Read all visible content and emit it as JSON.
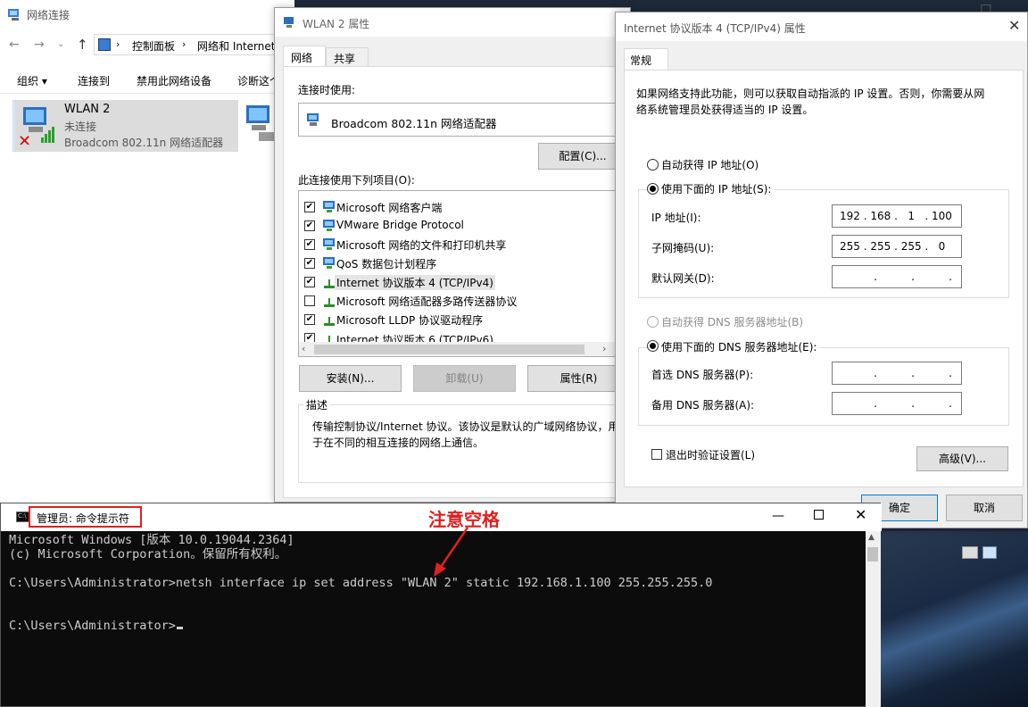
{
  "network_window": {
    "title": "网络连接",
    "breadcrumb": [
      "控制面板",
      "网络和 Internet"
    ],
    "toolbar": [
      "组织 ▾",
      "连接到",
      "禁用此网络设备",
      "诊断这个"
    ],
    "adapter": {
      "name": "WLAN 2",
      "status": "未连接",
      "device": "Broadcom 802.11n 网络适配器"
    }
  },
  "props_dialog": {
    "title": "WLAN 2 属性",
    "tabs": [
      "网络",
      "共享"
    ],
    "connect_using_label": "连接时使用:",
    "adapter_name": "Broadcom 802.11n 网络适配器",
    "configure_btn": "配置(C)...",
    "items_label": "此连接使用下列项目(O):",
    "items": [
      {
        "label": "Microsoft 网络客户端",
        "checked": true
      },
      {
        "label": "VMware Bridge Protocol",
        "checked": true
      },
      {
        "label": "Microsoft 网络的文件和打印机共享",
        "checked": true
      },
      {
        "label": "QoS 数据包计划程序",
        "checked": true
      },
      {
        "label": "Internet 协议版本 4 (TCP/IPv4)",
        "checked": true
      },
      {
        "label": "Microsoft 网络适配器多路传送器协议",
        "checked": false
      },
      {
        "label": "Microsoft LLDP 协议驱动程序",
        "checked": true
      },
      {
        "label": "Internet 协议版本 6 (TCP/IPv6)",
        "checked": true
      }
    ],
    "install_btn": "安装(N)...",
    "uninstall_btn": "卸载(U)",
    "properties_btn": "属性(R)",
    "desc_label": "描述",
    "desc_text_1": "传输控制协议/Internet 协议。该协议是默认的广域网络协议，用",
    "desc_text_2": "于在不同的相互连接的网络上通信。"
  },
  "ipv4_dialog": {
    "title": "Internet 协议版本 4 (TCP/IPv4) 属性",
    "tab": "常规",
    "info_1": "如果网络支持此功能，则可以获取自动指派的 IP 设置。否则，你需要从网",
    "info_2": "络系统管理员处获得适当的 IP 设置。",
    "auto_ip": "自动获得 IP 地址(O)",
    "manual_ip": "使用下面的 IP 地址(S):",
    "ip_label": "IP 地址(I):",
    "ip_value": "192 . 168 .   1   . 100",
    "mask_label": "子网掩码(U):",
    "mask_value": "255 . 255 . 255 .   0",
    "gateway_label": "默认网关(D):",
    "empty_ip": "          .          .          .",
    "auto_dns": "自动获得 DNS 服务器地址(B)",
    "manual_dns": "使用下面的 DNS 服务器地址(E):",
    "dns1_label": "首选 DNS 服务器(P):",
    "dns2_label": "备用 DNS 服务器(A):",
    "validate": "退出时验证设置(L)",
    "advanced_btn": "高级(V)...",
    "ok_btn": "确定",
    "cancel_btn": "取消"
  },
  "cmd": {
    "title": "管理员: 命令提示符",
    "lines": [
      "Microsoft Windows [版本 10.0.19044.2364]",
      "(c) Microsoft Corporation。保留所有权利。",
      "",
      "C:\\Users\\Administrator>netsh interface ip set address \"WLAN 2\" static 192.168.1.100 255.255.255.0",
      "",
      "",
      "C:\\Users\\Administrator>"
    ]
  },
  "annotation": {
    "text": "注意空格",
    "color": "#e02020"
  },
  "colors": {
    "accent": "#0078d7",
    "highlight_box": "#e02020",
    "cmd_bg": "#0c0c0c",
    "cmd_fg": "#cccccc"
  }
}
